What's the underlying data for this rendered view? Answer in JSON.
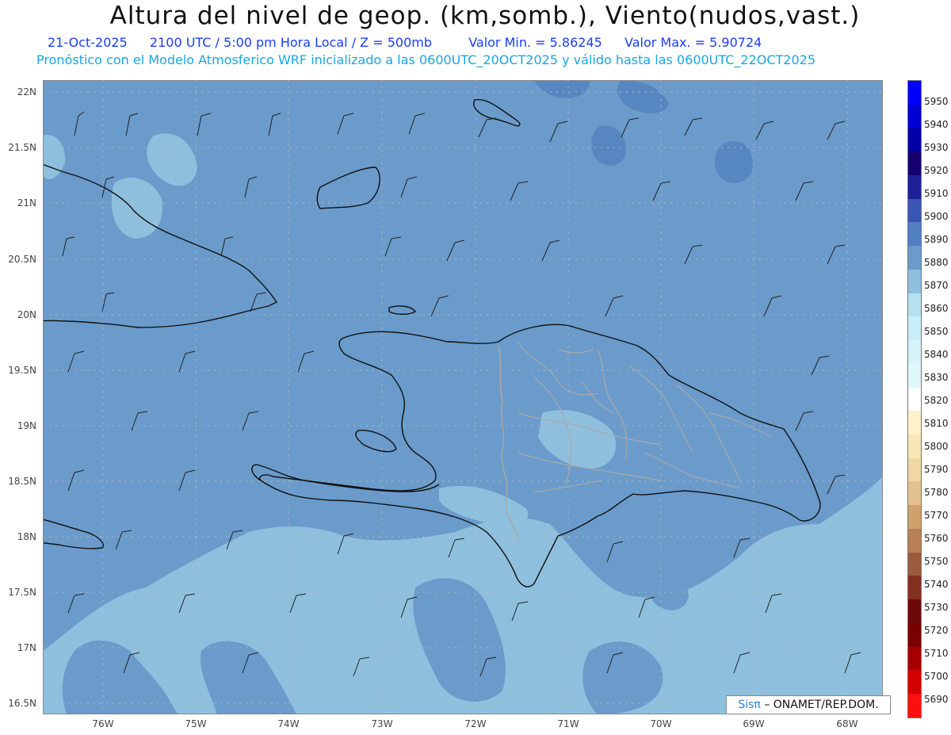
{
  "header": {
    "title": "Altura del nivel de geop. (km,somb.), Viento(nudos,vast.)",
    "date": "21-Oct-2025",
    "time": "2100 UTC / 5:00 pm Hora Local / Z = 500mb",
    "min_label": "Valor Min. = 5.86245",
    "max_label": "Valor Max. = 5.90724",
    "subtitle": "Pronóstico con el Modelo Atmosferico WRF inicializado a las 0600UTC_20OCT2025 y válido hasta las  0600UTC_22OCT2025"
  },
  "map": {
    "lat_labels": [
      "22N",
      "21.5N",
      "21N",
      "20.5N",
      "20N",
      "19.5N",
      "19N",
      "18.5N",
      "18N",
      "17.5N",
      "17N",
      "16.5N"
    ],
    "lon_labels": [
      "76W",
      "75W",
      "74W",
      "73W",
      "72W",
      "71W",
      "70W",
      "69W",
      "68W"
    ],
    "colors": {
      "sea_main": "#6a9bcb",
      "shade_dark": "#5787c0",
      "shade_light": "#8ec0de",
      "land_light": "#9ecbe4",
      "coast": "#111111",
      "borders": "#a8a8a8",
      "grid": "#b9b9b9"
    }
  },
  "colorbar": {
    "levels": [
      "5950",
      "5940",
      "5930",
      "5920",
      "5910",
      "5900",
      "5890",
      "5880",
      "5870",
      "5860",
      "5850",
      "5840",
      "5830",
      "5820",
      "5810",
      "5800",
      "5790",
      "5780",
      "5770",
      "5760",
      "5750",
      "5740",
      "5730",
      "5720",
      "5710",
      "5700",
      "5690"
    ],
    "colors": [
      "#0000ff",
      "#0000d2",
      "#0000a8",
      "#16006e",
      "#1e1e96",
      "#3a55b2",
      "#5080c0",
      "#6a9bcb",
      "#8ec0de",
      "#b4e0ee",
      "#c8eef6",
      "#d6f3f8",
      "#dff7fa",
      "#ffffff",
      "#fdf2c8",
      "#f8e6b6",
      "#f0d8a4",
      "#e4c290",
      "#cfa06c",
      "#b78055",
      "#9b5c3e",
      "#82301e",
      "#6c0a0a",
      "#7a0000",
      "#a80000",
      "#d40000",
      "#ff1010"
    ]
  },
  "credit": {
    "sis": "Sisπ",
    "text": "– ONAMET/REP.DOM."
  }
}
